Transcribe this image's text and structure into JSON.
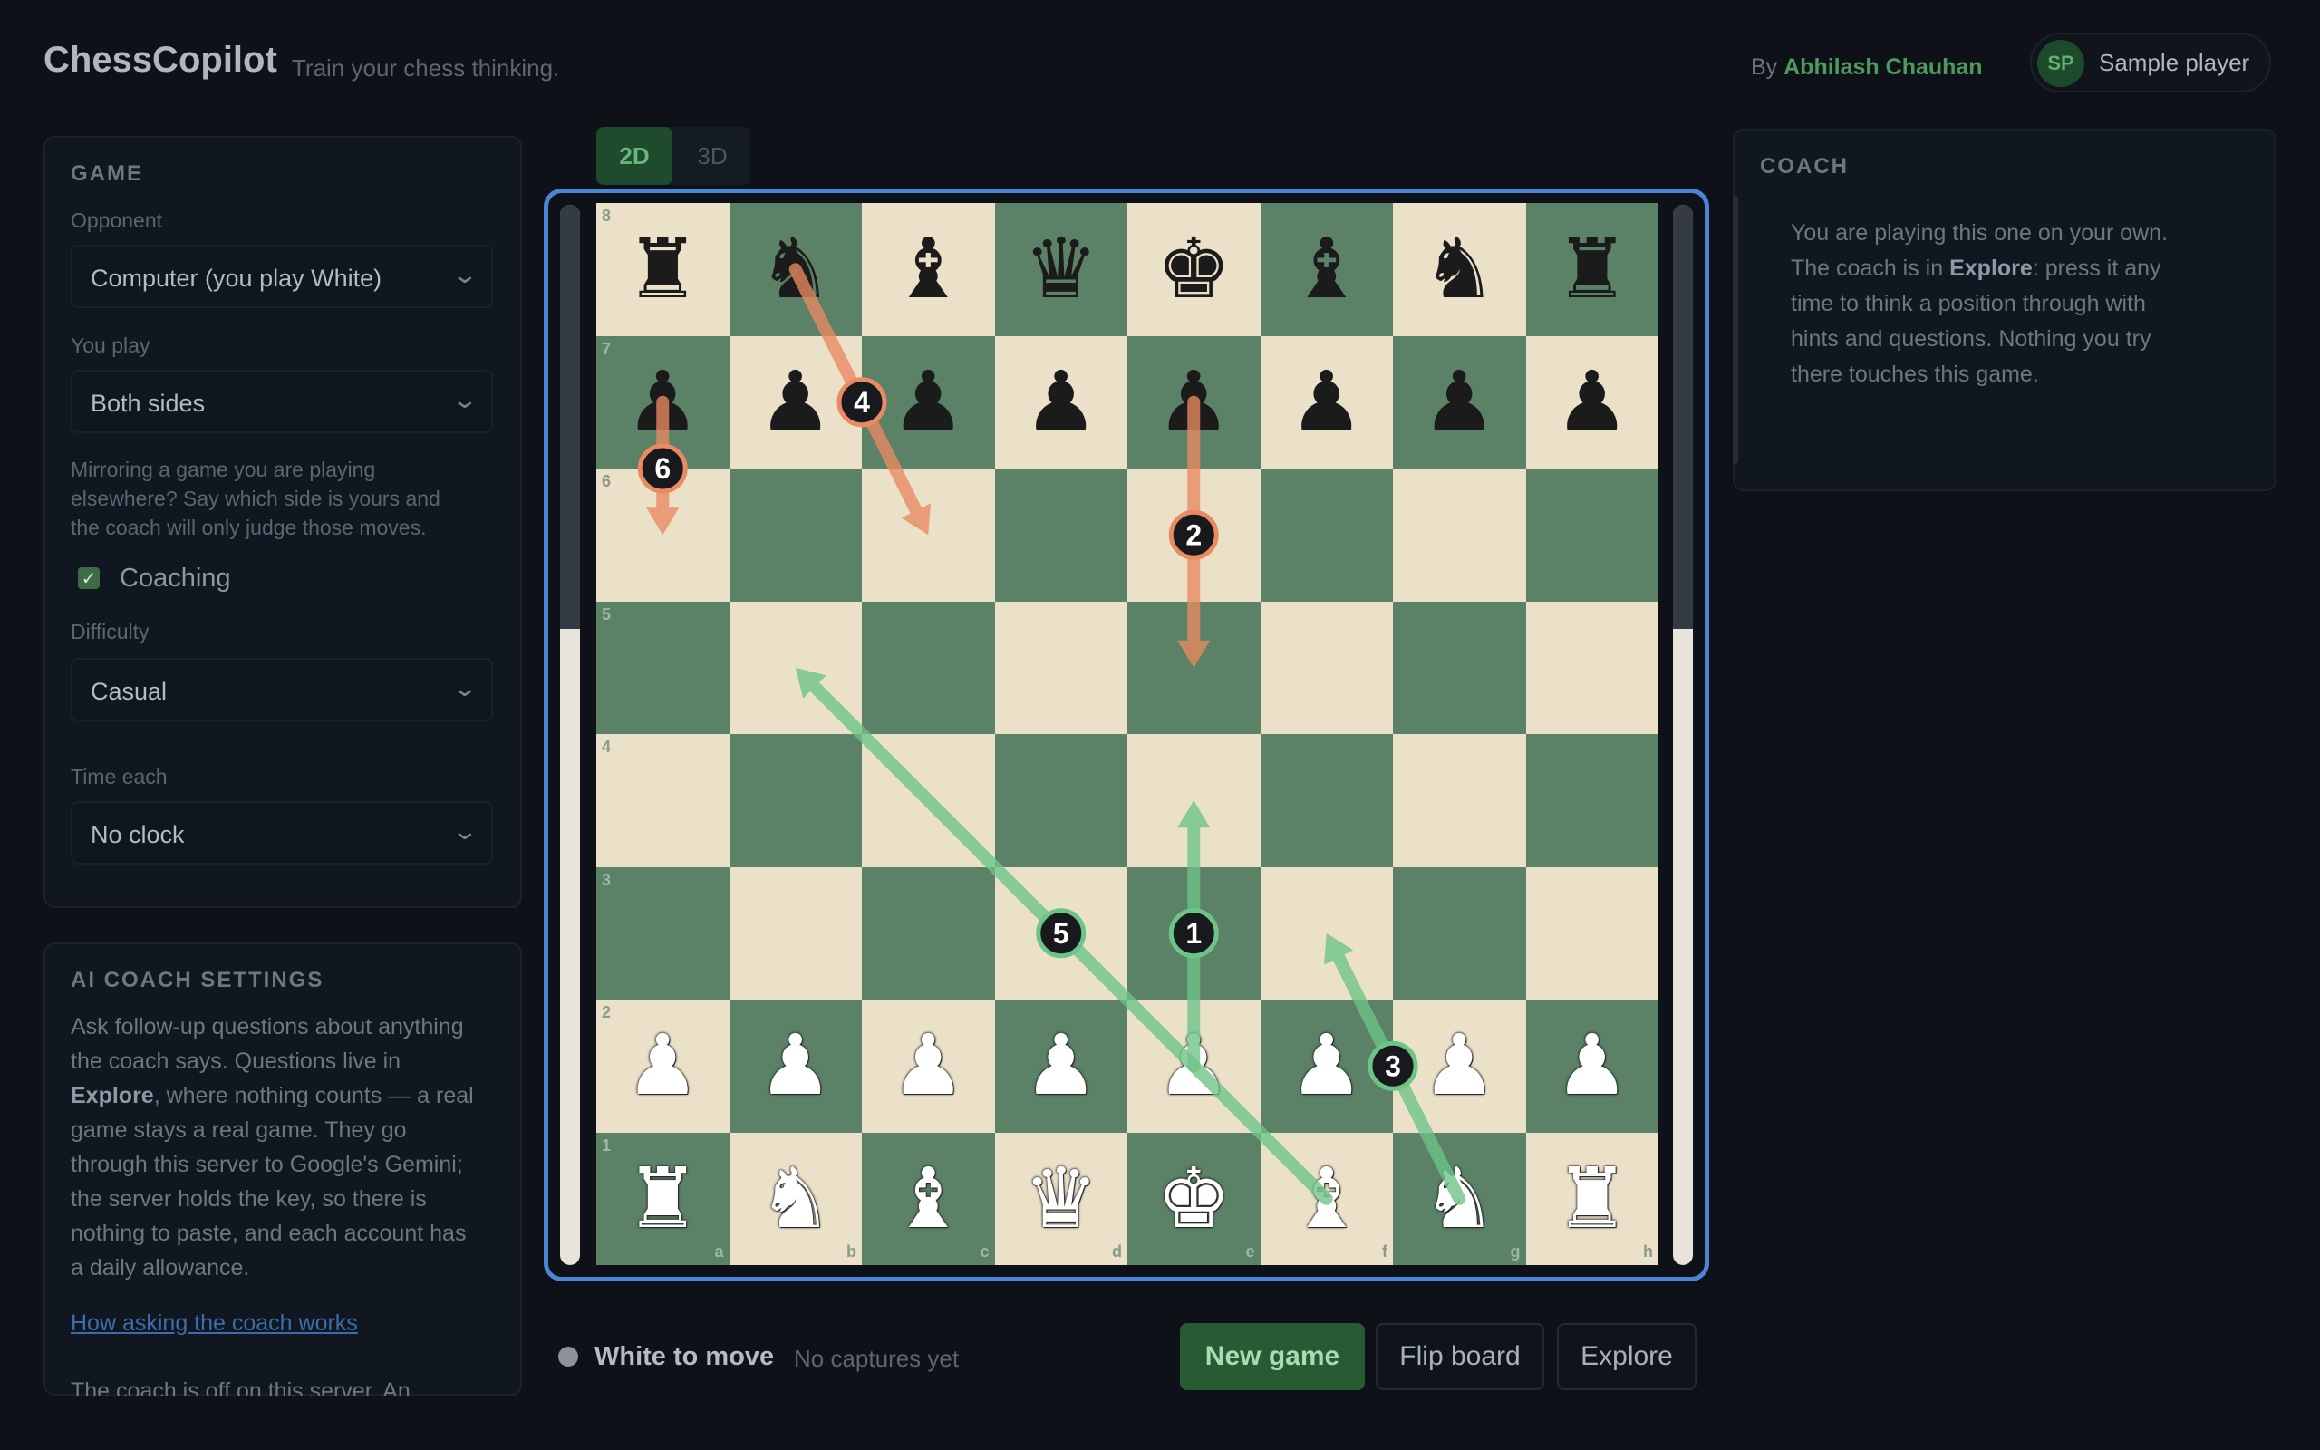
{
  "header": {
    "brand": "ChessCopilot",
    "tagline": "Train your chess thinking.",
    "by_prefix": "By ",
    "author": "Abhilash Chauhan",
    "avatar_initials": "SP",
    "player_name": "Sample player"
  },
  "game_panel": {
    "title": "GAME",
    "opponent_label": "Opponent",
    "opponent_value": "Computer (you play White)",
    "you_play_label": "You play",
    "you_play_value": "Both sides",
    "mirror_note_1": "Mirroring a game you are playing",
    "mirror_note_2": "elsewhere? Say which side is yours and",
    "mirror_note_3": "the coach will only judge those moves.",
    "coaching_label": "Coaching",
    "coaching_checked": true,
    "difficulty_label": "Difficulty",
    "difficulty_value": "Casual",
    "time_label": "Time each",
    "time_value": "No clock"
  },
  "ai_panel": {
    "title": "AI COACH SETTINGS",
    "line_1": "Ask follow-up questions about anything",
    "line_2": "the coach says. Questions live in",
    "line_3_bold": "Explore",
    "line_3_rest": ", where nothing counts — a real",
    "line_4": "game stays a real game. They go",
    "line_5": "through this server to Google's Gemini;",
    "line_6": "the server holds the key, so there is",
    "line_7": "nothing to paste, and each account has",
    "line_8": "a daily allowance.",
    "link": "How asking the coach works",
    "footer": "The coach is off on this server. An"
  },
  "coach_panel": {
    "title": "COACH",
    "line_1": "You are playing this one on your own.",
    "line_2_pre": "The coach is in ",
    "line_2_bold": "Explore",
    "line_2_post": ": press it any",
    "line_3": "time to think a position through with",
    "line_4": "hints and questions. Nothing you try",
    "line_5": "there touches this game."
  },
  "view_tabs": [
    "2D",
    "3D"
  ],
  "view_active": "2D",
  "board": {
    "files": [
      "a",
      "b",
      "c",
      "d",
      "e",
      "f",
      "g",
      "h"
    ],
    "ranks": [
      "8",
      "7",
      "6",
      "5",
      "4",
      "3",
      "2",
      "1"
    ],
    "position": [
      "rnbqkbnr",
      "pppppppp",
      "........",
      "........",
      "........",
      "........",
      "PPPPPPPP",
      "RNBQKBNR"
    ],
    "arrows": [
      {
        "label": "1",
        "from": "e2",
        "to": "e4",
        "color": "#6cc487"
      },
      {
        "label": "2",
        "from": "e7",
        "to": "e5",
        "color": "#ea8a62"
      },
      {
        "label": "3",
        "from": "g1",
        "to": "f3",
        "color": "#6cc487"
      },
      {
        "label": "4",
        "from": "b8",
        "to": "c6",
        "color": "#ea8a62"
      },
      {
        "label": "5",
        "from": "f1",
        "to": "b5",
        "color": "#6cc487"
      },
      {
        "label": "6",
        "from": "a7",
        "to": "a6",
        "color": "#ea8a62"
      }
    ],
    "eval_white_fraction": 0.6
  },
  "status": {
    "turn": "White to move",
    "captures": "No captures yet"
  },
  "buttons": {
    "new_game": "New game",
    "flip_board": "Flip board",
    "explore": "Explore"
  },
  "colors": {
    "accent_green": "#285a34",
    "board_light": "#ebe0c8",
    "board_dark": "#5b8266",
    "frame_blue": "#4a86d8"
  }
}
